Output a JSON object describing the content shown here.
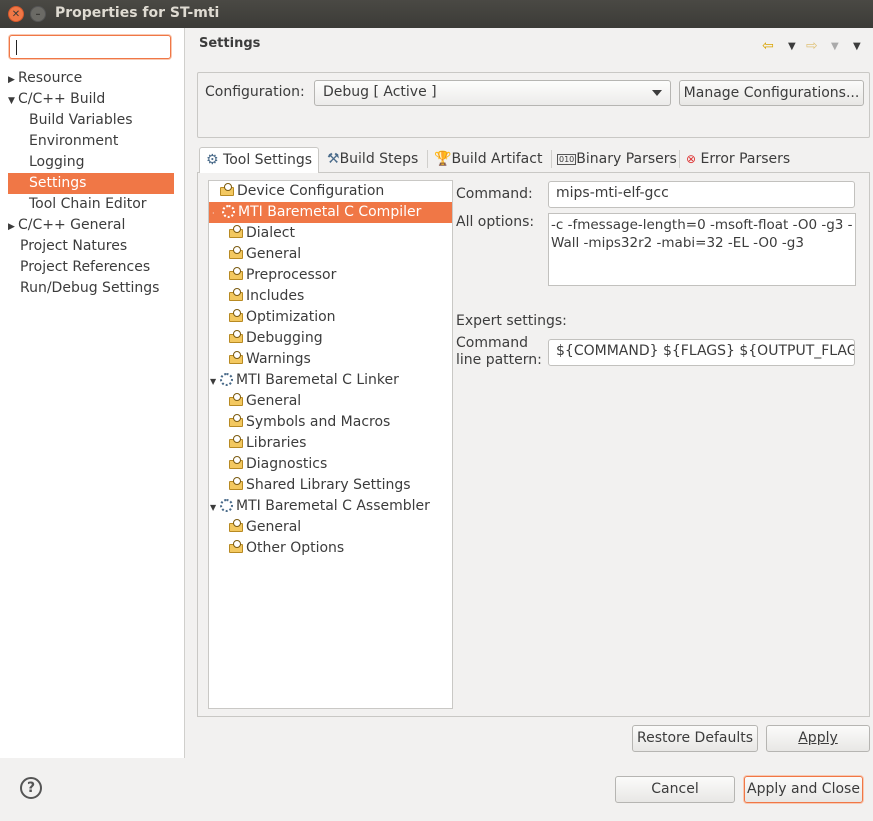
{
  "window": {
    "title": "Properties for ST-mti"
  },
  "filter": {
    "value": ""
  },
  "nav": {
    "items": [
      {
        "label": "Resource",
        "expander": "collapsed"
      },
      {
        "label": "C/C++ Build",
        "expander": "expanded"
      },
      {
        "label": "Build Variables"
      },
      {
        "label": "Environment"
      },
      {
        "label": "Logging"
      },
      {
        "label": "Settings",
        "selected": true
      },
      {
        "label": "Tool Chain Editor"
      },
      {
        "label": "C/C++ General",
        "expander": "collapsed"
      },
      {
        "label": "Project Natures"
      },
      {
        "label": "Project References"
      },
      {
        "label": "Run/Debug Settings"
      }
    ]
  },
  "header": {
    "title": "Settings"
  },
  "config": {
    "label": "Configuration:",
    "value": "Debug  [ Active ]",
    "manage_label": "Manage Configurations..."
  },
  "tabs": [
    {
      "label": "Tool Settings",
      "icon": "tool-settings-icon",
      "active": true
    },
    {
      "label": "Build Steps",
      "icon": "build-steps-icon"
    },
    {
      "label": "Build Artifact",
      "icon": "trophy-icon"
    },
    {
      "label": "Binary Parsers",
      "icon": "binary-icon"
    },
    {
      "label": "Error Parsers",
      "icon": "error-icon"
    }
  ],
  "tool_tree": [
    {
      "label": "Device Configuration",
      "icon": "folder-options-icon",
      "level": 1
    },
    {
      "label": "MTI Baremetal C Compiler",
      "icon": "gear-icon",
      "level": 0,
      "selected": true
    },
    {
      "label": "Dialect",
      "icon": "folder-options-icon",
      "level": 2
    },
    {
      "label": "General",
      "icon": "folder-options-icon",
      "level": 2
    },
    {
      "label": "Preprocessor",
      "icon": "folder-options-icon",
      "level": 2
    },
    {
      "label": "Includes",
      "icon": "folder-options-icon",
      "level": 2
    },
    {
      "label": "Optimization",
      "icon": "folder-options-icon",
      "level": 2
    },
    {
      "label": "Debugging",
      "icon": "folder-options-icon",
      "level": 2
    },
    {
      "label": "Warnings",
      "icon": "folder-options-icon",
      "level": 2
    },
    {
      "label": "MTI Baremetal C Linker",
      "icon": "gear-icon",
      "level": 0
    },
    {
      "label": "General",
      "icon": "folder-options-icon",
      "level": 2
    },
    {
      "label": "Symbols and Macros",
      "icon": "folder-options-icon",
      "level": 2
    },
    {
      "label": "Libraries",
      "icon": "folder-options-icon",
      "level": 2
    },
    {
      "label": "Diagnostics",
      "icon": "folder-options-icon",
      "level": 2
    },
    {
      "label": "Shared Library Settings",
      "icon": "folder-options-icon",
      "level": 2
    },
    {
      "label": "MTI Baremetal C Assembler",
      "icon": "gear-icon",
      "level": 0
    },
    {
      "label": "General",
      "icon": "folder-options-icon",
      "level": 2
    },
    {
      "label": "Other Options",
      "icon": "folder-options-icon",
      "level": 2
    }
  ],
  "details": {
    "command_label": "Command:",
    "command_value": "mips-mti-elf-gcc",
    "all_options_label": "All options:",
    "all_options_value": "-c -fmessage-length=0 -msoft-float -O0 -g3 -Wall -mips32r2 -mabi=32 -EL -O0 -g3",
    "expert_label": "Expert settings:",
    "pattern_label_1": "Command",
    "pattern_label_2": "line pattern:",
    "pattern_value": "${COMMAND} ${FLAGS} ${OUTPUT_FLAG} ${"
  },
  "buttons": {
    "restore_defaults": "Restore Defaults",
    "apply": "Apply",
    "cancel": "Cancel",
    "apply_and_close": "Apply and Close"
  },
  "colors": {
    "accent": "#f07746",
    "panel_bg": "#f2f1f0",
    "titlebar": "#3c3b37"
  }
}
